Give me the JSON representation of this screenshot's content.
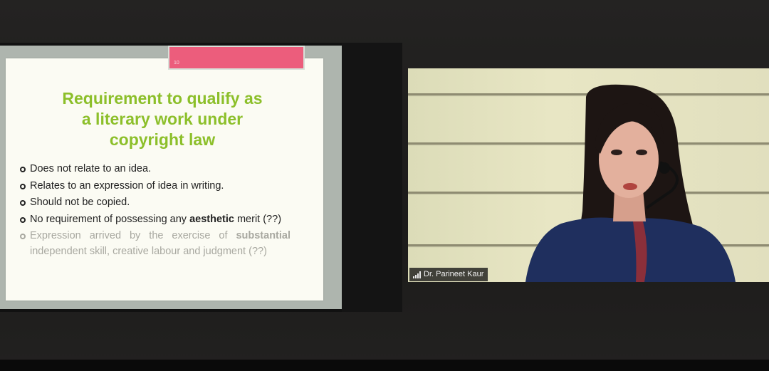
{
  "slide": {
    "number": "10",
    "title_lines": [
      "Requirement to qualify as",
      "a literary work under",
      "copyright law"
    ],
    "bullets": [
      {
        "text": "Does not relate to an idea."
      },
      {
        "text": "Relates to an expression of idea in writing."
      },
      {
        "text": "Should not be copied."
      },
      {
        "before": "No requirement of possessing any ",
        "bold": "aesthetic",
        "after": " merit (??)"
      },
      {
        "before": "Expression arrived by the exercise of ",
        "bold": "substantial",
        "after": " independent skill, creative labour and judgment (??)"
      }
    ]
  },
  "video": {
    "participant_name": "Dr. Parineet Kaur"
  },
  "colors": {
    "title_green": "#8cbf2a",
    "tab_pink": "#ec5d7c",
    "wall_cream": "#e4e2c0"
  },
  "icons": [
    "signal-strength-icon"
  ]
}
